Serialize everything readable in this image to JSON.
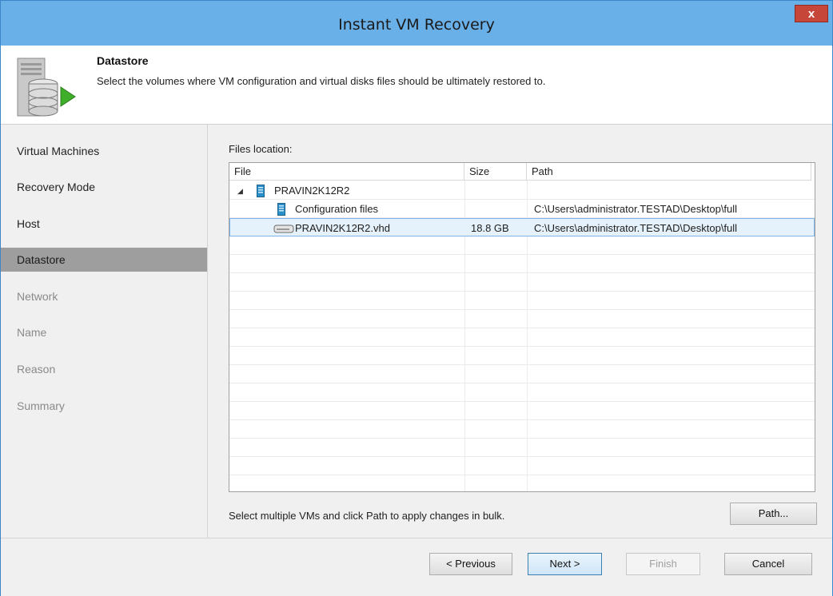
{
  "window": {
    "title": "Instant VM Recovery",
    "close_label": "x"
  },
  "header": {
    "title": "Datastore",
    "description": "Select the volumes where VM configuration and virtual disks files should be ultimately restored to.",
    "icon": "datastore-icon"
  },
  "sidebar": {
    "items": [
      {
        "label": "Virtual Machines",
        "state": "normal"
      },
      {
        "label": "Recovery Mode",
        "state": "normal"
      },
      {
        "label": "Host",
        "state": "normal"
      },
      {
        "label": "Datastore",
        "state": "active"
      },
      {
        "label": "Network",
        "state": "disabled"
      },
      {
        "label": "Name",
        "state": "disabled"
      },
      {
        "label": "Reason",
        "state": "disabled"
      },
      {
        "label": "Summary",
        "state": "disabled"
      }
    ]
  },
  "files": {
    "label": "Files location:",
    "columns": {
      "file": "File",
      "size": "Size",
      "path": "Path"
    },
    "rows": [
      {
        "expander": "◢",
        "icon": "server-icon",
        "file": "PRAVIN2K12R2",
        "size": "",
        "path": ""
      },
      {
        "icon": "config-file-icon",
        "file": "Configuration files",
        "size": "",
        "path": "C:\\Users\\administrator.TESTAD\\Desktop\\full"
      },
      {
        "icon": "disk-icon",
        "file": "PRAVIN2K12R2.vhd",
        "size": "18.8 GB",
        "path": "C:\\Users\\administrator.TESTAD\\Desktop\\full",
        "selected": true
      }
    ]
  },
  "bulk": {
    "hint": "Select multiple VMs and click Path to apply changes in bulk.",
    "path_button": "Path..."
  },
  "footer": {
    "previous": "< Previous",
    "next": "Next >",
    "finish": "Finish",
    "cancel": "Cancel"
  },
  "colors": {
    "titlebar": "#6ab0e8",
    "close": "#c7463a",
    "active_nav": "#9e9e9e",
    "selection": "#e5f1fb"
  }
}
